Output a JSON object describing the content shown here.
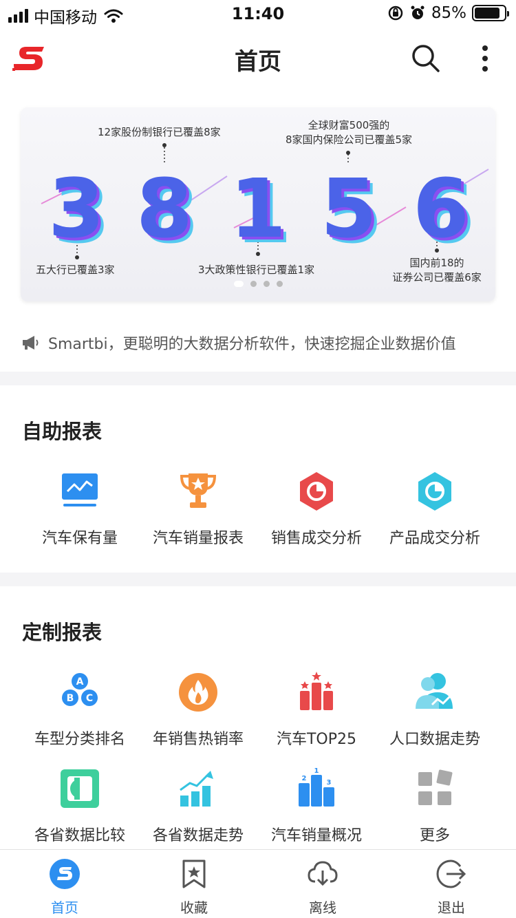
{
  "status_bar": {
    "carrier": "中国移动",
    "time": "11:40",
    "battery_percent": "85%",
    "battery_level": 0.85
  },
  "nav": {
    "title": "首页",
    "logo_icon": "smartbi-logo",
    "search_icon": "search-icon",
    "more_icon": "more-vertical-icon"
  },
  "banner": {
    "digits": [
      "3",
      "8",
      "1",
      "5",
      "6"
    ],
    "annotations": {
      "a1": "五大行已覆盖3家",
      "a2": "12家股份制银行已覆盖8家",
      "a3": "3大政策性银行已覆盖1家",
      "a4_line1": "全球财富500强的",
      "a4_line2": "8家国内保险公司已覆盖5家",
      "a5_line1": "国内前18的",
      "a5_line2": "证券公司已覆盖6家"
    },
    "page_count": 4,
    "active_page": 1
  },
  "notice": {
    "text": "Smartbi，更聪明的大数据分析软件，快速挖掘企业数据价值"
  },
  "self_service": {
    "title": "自助报表",
    "items": [
      {
        "label": "汽车保有量",
        "icon": "monitor-chart-icon"
      },
      {
        "label": "汽车销量报表",
        "icon": "trophy-icon"
      },
      {
        "label": "销售成交分析",
        "icon": "pie-hexagon-red-icon"
      },
      {
        "label": "产品成交分析",
        "icon": "pie-hexagon-cyan-icon"
      }
    ]
  },
  "custom": {
    "title": "定制报表",
    "items": [
      {
        "label": "车型分类排名",
        "icon": "abc-circles-icon"
      },
      {
        "label": "年销售热销率",
        "icon": "flame-icon"
      },
      {
        "label": "汽车TOP25",
        "icon": "bar-stars-icon"
      },
      {
        "label": "人口数据走势",
        "icon": "people-trend-icon"
      },
      {
        "label": "各省数据比较",
        "icon": "compare-icon"
      },
      {
        "label": "各省数据走势",
        "icon": "trend-bars-icon"
      },
      {
        "label": "汽车销量概况",
        "icon": "podium-icon"
      },
      {
        "label": "更多",
        "icon": "more-grid-icon"
      }
    ]
  },
  "tabbar": {
    "tabs": [
      {
        "label": "首页",
        "icon": "home-logo-icon",
        "active": true
      },
      {
        "label": "收藏",
        "icon": "bookmark-icon",
        "active": false
      },
      {
        "label": "离线",
        "icon": "cloud-download-icon",
        "active": false
      },
      {
        "label": "退出",
        "icon": "logout-icon",
        "active": false
      }
    ]
  },
  "colors": {
    "primary_blue": "#2d8ff0",
    "red": "#e8494a",
    "orange": "#f5923e",
    "cyan": "#34c3e0",
    "green": "#3ecf9c",
    "gray": "#a9a9a9"
  }
}
